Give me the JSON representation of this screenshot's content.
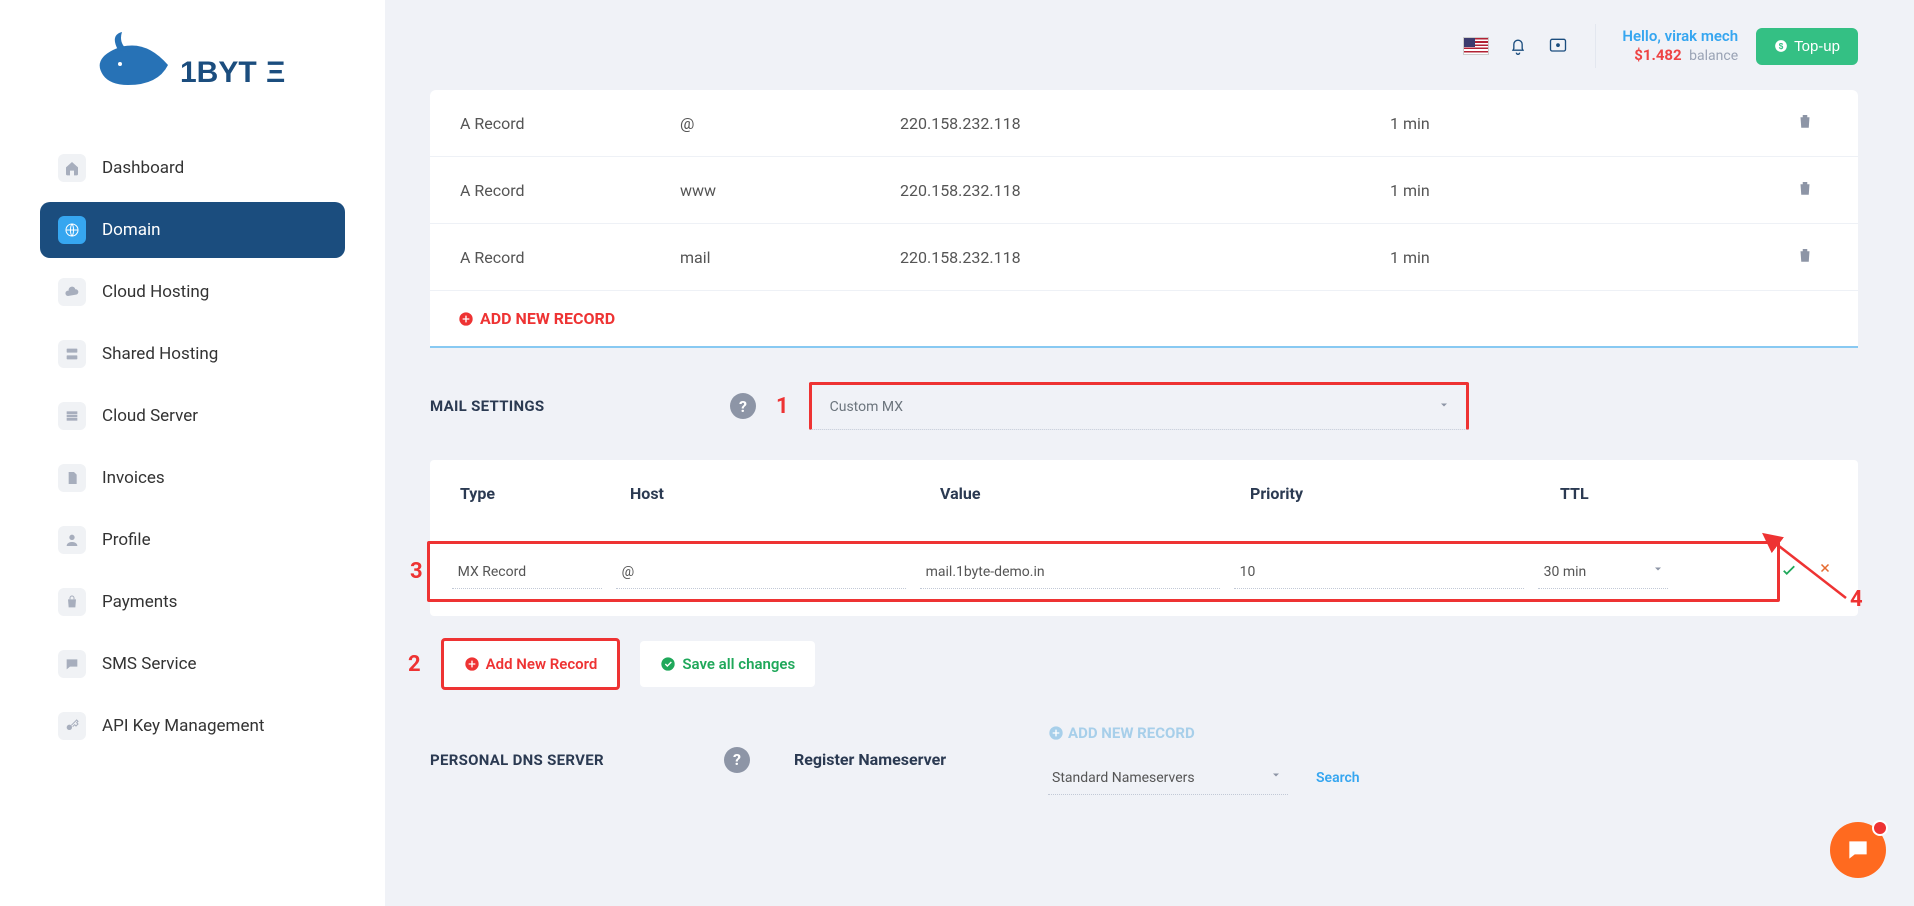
{
  "brand": "1BYTE",
  "sidebar": {
    "items": [
      {
        "label": "Dashboard"
      },
      {
        "label": "Domain"
      },
      {
        "label": "Cloud Hosting"
      },
      {
        "label": "Shared Hosting"
      },
      {
        "label": "Cloud Server"
      },
      {
        "label": "Invoices"
      },
      {
        "label": "Profile"
      },
      {
        "label": "Payments"
      },
      {
        "label": "SMS Service"
      },
      {
        "label": "API Key Management"
      }
    ]
  },
  "header": {
    "hello": "Hello, virak mech",
    "balance_amount": "$1.482",
    "balance_label": "balance",
    "topup": "Top-up"
  },
  "records": [
    {
      "type": "A Record",
      "host": "@",
      "value": "220.158.232.118",
      "ttl": "1 min"
    },
    {
      "type": "A Record",
      "host": "www",
      "value": "220.158.232.118",
      "ttl": "1 min"
    },
    {
      "type": "A Record",
      "host": "mail",
      "value": "220.158.232.118",
      "ttl": "1 min"
    }
  ],
  "add_new_record_top": "ADD NEW RECORD",
  "mail": {
    "title": "MAIL SETTINGS",
    "select": "Custom MX",
    "annotation1": "1"
  },
  "mx": {
    "headers": {
      "type": "Type",
      "host": "Host",
      "value": "Value",
      "priority": "Priority",
      "ttl": "TTL"
    },
    "row": {
      "type": "MX Record",
      "host": "@",
      "value": "mail.1byte-demo.in",
      "priority": "10",
      "ttl": "30 min"
    },
    "annotation3": "3",
    "annotation4": "4"
  },
  "buttons": {
    "add_new": "Add New Record",
    "save_all": "Save all changes",
    "annotation2": "2"
  },
  "dns": {
    "title": "PERSONAL DNS SERVER",
    "reg": "Register Nameserver",
    "add": "ADD NEW RECORD",
    "std": "Standard Nameservers",
    "search": "Search"
  }
}
